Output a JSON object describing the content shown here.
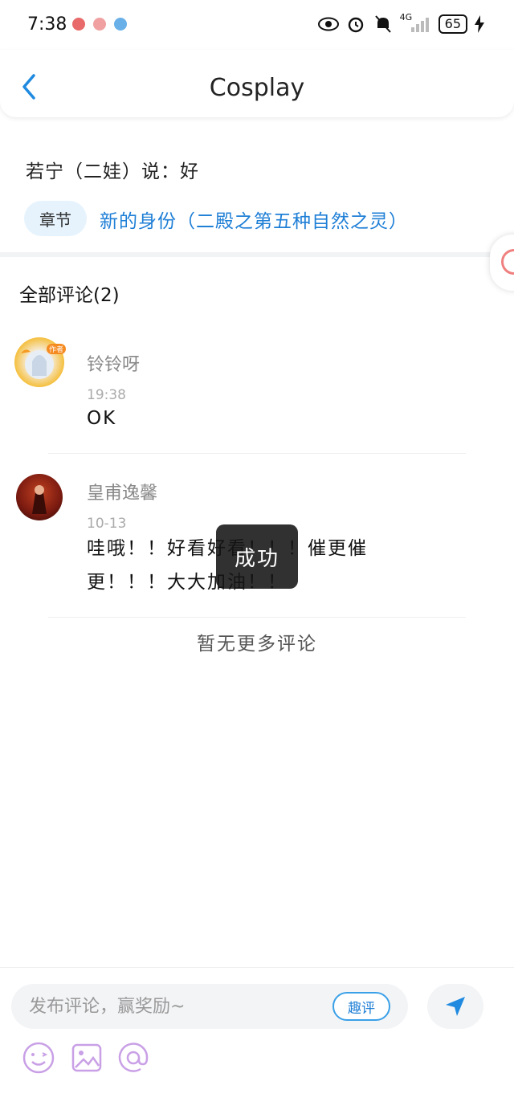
{
  "status": {
    "time": "7:38",
    "network": "4G",
    "battery": "65"
  },
  "nav": {
    "title": "Cosplay"
  },
  "header": {
    "quote": "若宁（二娃）说：好",
    "chapter_tag": "章节",
    "chapter_link": "新的身份（二殿之第五种自然之灵）"
  },
  "comments_section": {
    "title": "全部评论(2)",
    "items": [
      {
        "name": "铃铃呀",
        "time": "19:38",
        "text": "OK",
        "badge": "作者"
      },
      {
        "name": "皇甫逸馨",
        "time": "10-13",
        "text": "哇哦！！好看好看！！！催更催更！！！大大加油！！"
      }
    ],
    "no_more": "暂无更多评论"
  },
  "toast": {
    "text": "成功"
  },
  "composer": {
    "placeholder": "发布评论，赢奖励~",
    "badge": "趣评"
  },
  "colors": {
    "accent": "#1f7fd6",
    "tool_icon": "#c9a0e6"
  }
}
